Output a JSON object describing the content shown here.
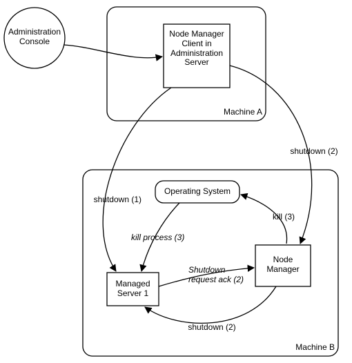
{
  "nodes": {
    "admin_console": "Administration\nConsole",
    "nm_client": "Node Manager\nClient in\nAdministration\nServer",
    "machine_a": "Machine A",
    "machine_b": "Machine B",
    "operating_system": "Operating System",
    "node_manager": "Node\nManager",
    "managed_server": "Managed\nServer 1"
  },
  "edges": {
    "shutdown_1": "shutdown (1)",
    "shutdown_2a": "shutdown (2)",
    "shutdown_2b": "shutdown (2)",
    "kill_process_3": "kill process (3)",
    "kill_3": "kill (3)",
    "shutdown_req_ack": "Shutdown\nrequest ack (2)"
  },
  "chart_data": {
    "type": "diagram",
    "title": "",
    "nodes": [
      {
        "id": "admin_console",
        "label": "Administration Console",
        "shape": "circle",
        "container": null
      },
      {
        "id": "machine_a",
        "label": "Machine A",
        "shape": "rounded-rect",
        "container": null
      },
      {
        "id": "nm_client",
        "label": "Node Manager Client in Administration Server",
        "shape": "rect",
        "container": "machine_a"
      },
      {
        "id": "machine_b",
        "label": "Machine B",
        "shape": "rounded-rect",
        "container": null
      },
      {
        "id": "operating_system",
        "label": "Operating System",
        "shape": "rounded-rect",
        "container": "machine_b"
      },
      {
        "id": "node_manager",
        "label": "Node Manager",
        "shape": "rect",
        "container": "machine_b"
      },
      {
        "id": "managed_server",
        "label": "Managed Server 1",
        "shape": "rect",
        "container": "machine_b"
      }
    ],
    "edges": [
      {
        "from": "admin_console",
        "to": "nm_client",
        "label": ""
      },
      {
        "from": "nm_client",
        "to": "managed_server",
        "label": "shutdown (1)"
      },
      {
        "from": "nm_client",
        "to": "node_manager",
        "label": "shutdown (2)"
      },
      {
        "from": "operating_system",
        "to": "managed_server",
        "label": "kill process (3)"
      },
      {
        "from": "node_manager",
        "to": "operating_system",
        "label": "kill (3)"
      },
      {
        "from": "managed_server",
        "to": "node_manager",
        "label": "Shutdown request ack (2)"
      },
      {
        "from": "node_manager",
        "to": "managed_server",
        "label": "shutdown (2)"
      }
    ]
  }
}
